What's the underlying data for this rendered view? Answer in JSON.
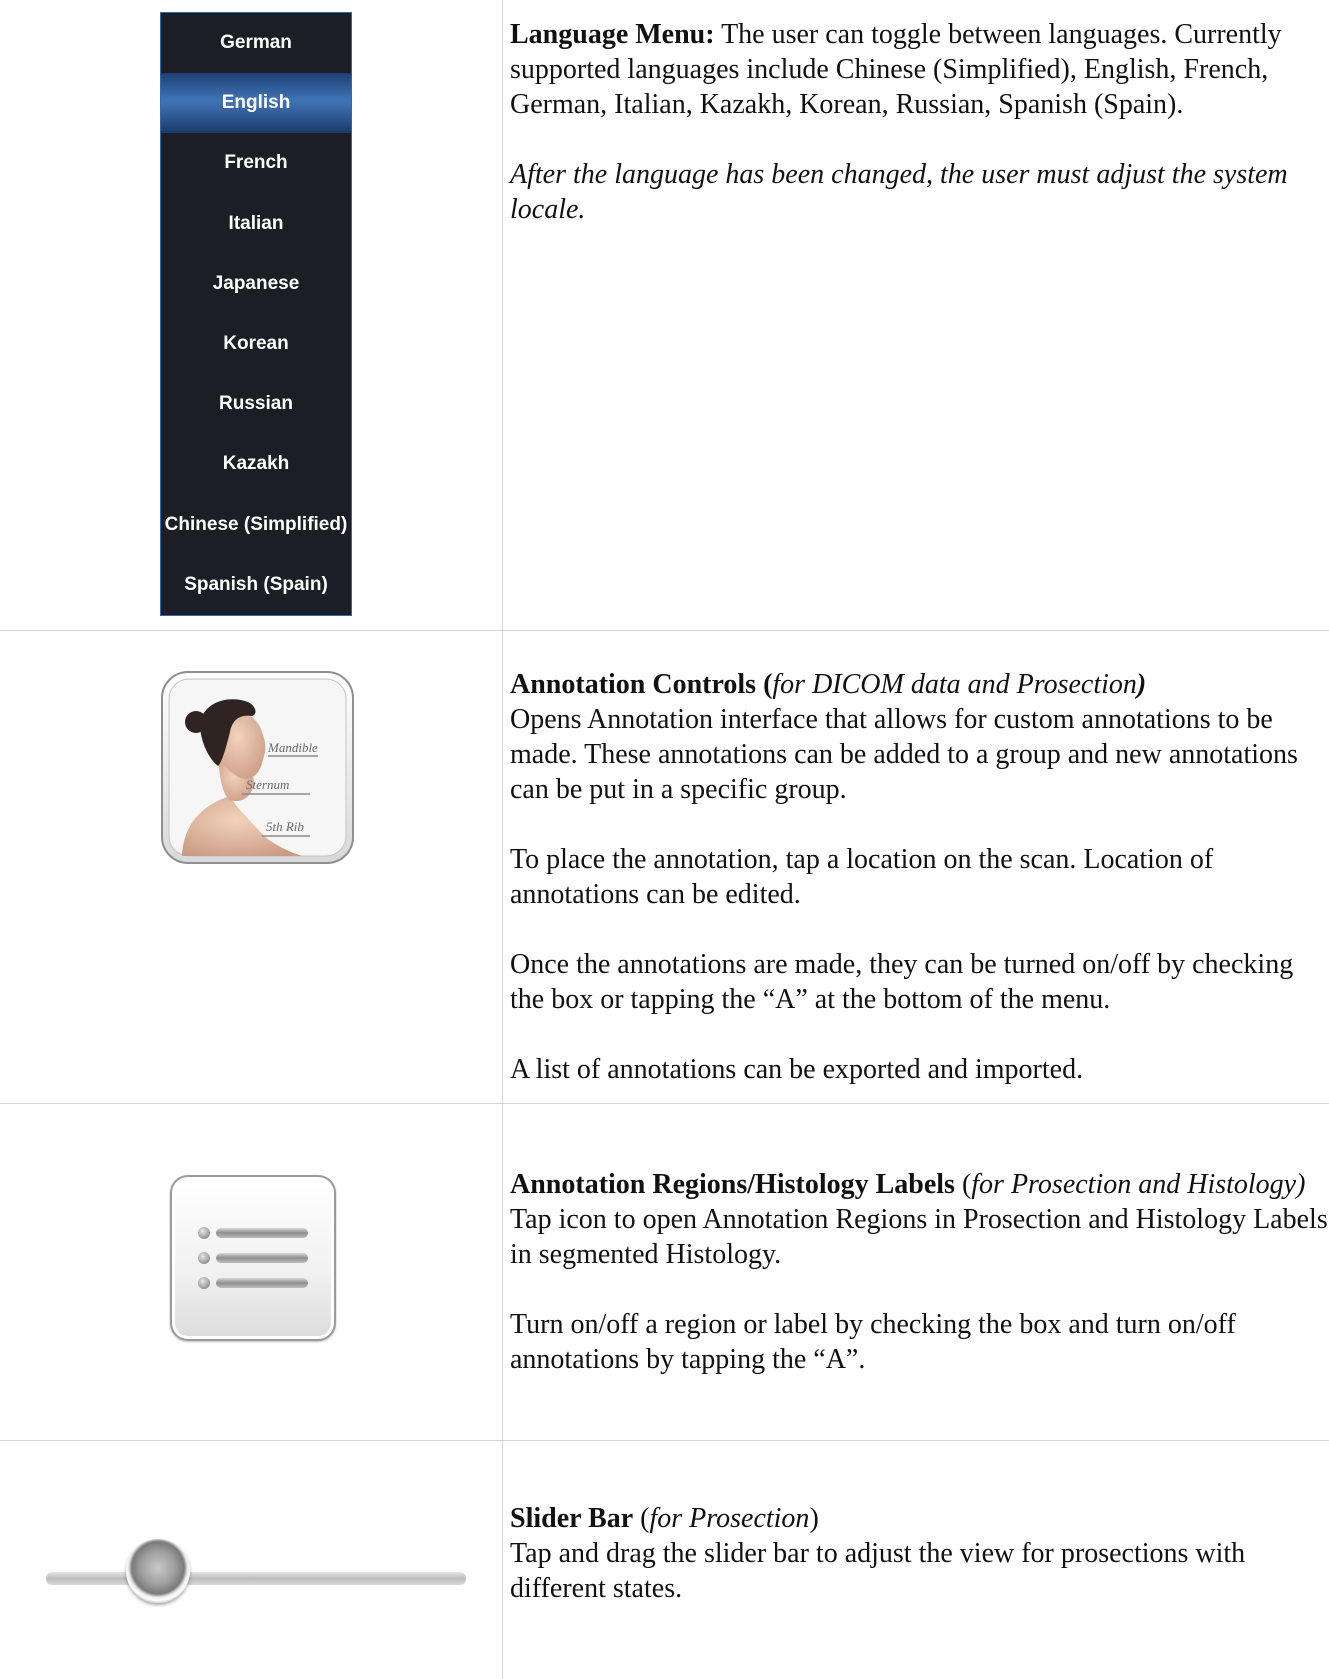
{
  "language_menu": {
    "items": [
      "German",
      "English",
      "French",
      "Italian",
      "Japanese",
      "Korean",
      "Russian",
      "Kazakh",
      "Chinese (Simplified)",
      "Spanish (Spain)"
    ],
    "selected": "English",
    "colors": {
      "background": "#1b1e24",
      "selected": "#3f73b6",
      "border": "#2d6ab0"
    }
  },
  "section1": {
    "heading": "Language Menu:",
    "description": " The user can toggle between languages. Currently supported languages include Chinese (Simplified), English, French, German, Italian, Kazakh, Korean, Russian, Spanish (Spain).",
    "note": "After the language has been changed, the user must adjust the system locale."
  },
  "section2": {
    "heading_prefix": "Annotation Controls (",
    "heading_italic": "for DICOM data and Prosection",
    "heading_suffix": ")",
    "icon_labels": [
      "Mandible",
      "Sternum",
      "5th Rib"
    ],
    "paragraphs": [
      "Opens Annotation interface that allows for custom annotations to be made. These annotations can be added to a group and new annotations can be put in a specific group.",
      "To place the annotation, tap a location on the scan. Location of annotations can be edited.",
      "Once the annotations are made, they can be turned on/off by checking the box or tapping the “A” at the bottom of the menu.",
      "A list of annotations can be exported and imported."
    ]
  },
  "section3": {
    "heading_bold": "Annotation Regions/Histology Labels",
    "heading_open": " (",
    "heading_italic": "for Prosection and Histology)",
    "paragraphs": [
      "Tap icon to open Annotation Regions in Prosection and Histology Labels in segmented Histology.",
      "Turn on/off a region or label by checking the box and turn on/off annotations by tapping the “A”."
    ]
  },
  "section4": {
    "heading_bold": "Slider Bar",
    "heading_open": " (",
    "heading_italic": "for Prosection",
    "heading_close": ")",
    "paragraph": "Tap and drag the slider bar to adjust the view for prosections with different states."
  }
}
